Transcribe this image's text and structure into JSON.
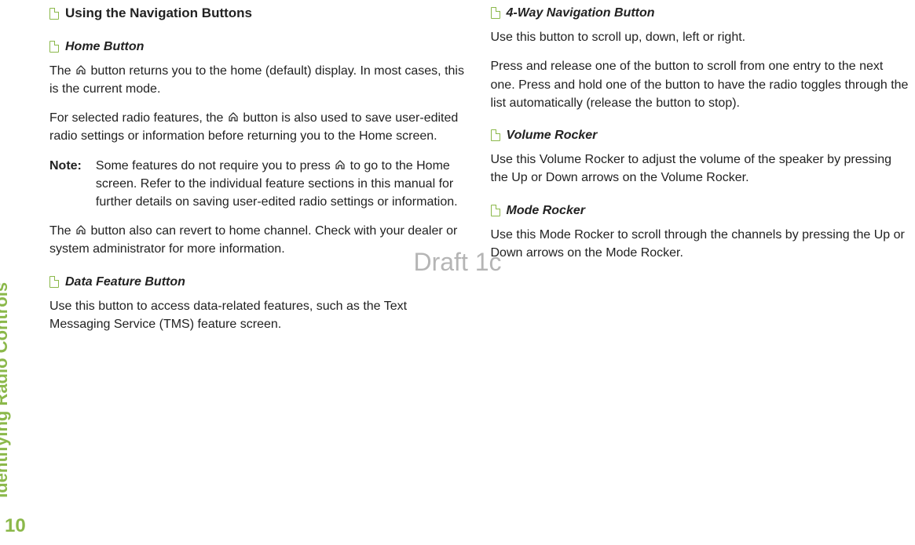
{
  "sidebar": {
    "section_label": "Identifying Radio Controls",
    "page_number": "10"
  },
  "watermark": "Draft 1c",
  "col1": {
    "h1": "Using the Navigation Buttons",
    "home": {
      "title": "Home Button",
      "p1_a": "The ",
      "p1_b": " button returns you to the home (default) display. In most cases, this is the current mode.",
      "p2_a": "For selected radio features, the ",
      "p2_b": " button is also used to save user-edited radio settings or information before returning you to the Home screen.",
      "note_label": "Note:",
      "note_a": "Some features do not require you to press ",
      "note_b": " to go to the Home screen. Refer to the individual feature sections in this manual for further details on saving user-edited radio settings or information.",
      "p3_a": "The ",
      "p3_b": " button also can revert to home channel. Check with your dealer or system administrator for more information."
    },
    "data_feature": {
      "title": "Data Feature Button",
      "p1": "Use this button to access data-related features, such as the Text Messaging Service (TMS) feature screen."
    }
  },
  "col2": {
    "nav4": {
      "title": "4-Way Navigation Button",
      "p1": "Use this button to scroll up, down, left or right.",
      "p2": "Press and release one of the button to scroll from one entry to the next one. Press and hold one of the button to have the radio toggles through the list automatically (release the button to stop)."
    },
    "volume": {
      "title": "Volume Rocker",
      "p1": "Use this Volume Rocker to adjust the volume of the speaker by pressing the Up or Down arrows on the Volume Rocker."
    },
    "mode": {
      "title": "Mode Rocker",
      "p1": "Use this Mode Rocker to scroll through the channels by pressing the Up or Down arrows on the Mode Rocker."
    }
  }
}
